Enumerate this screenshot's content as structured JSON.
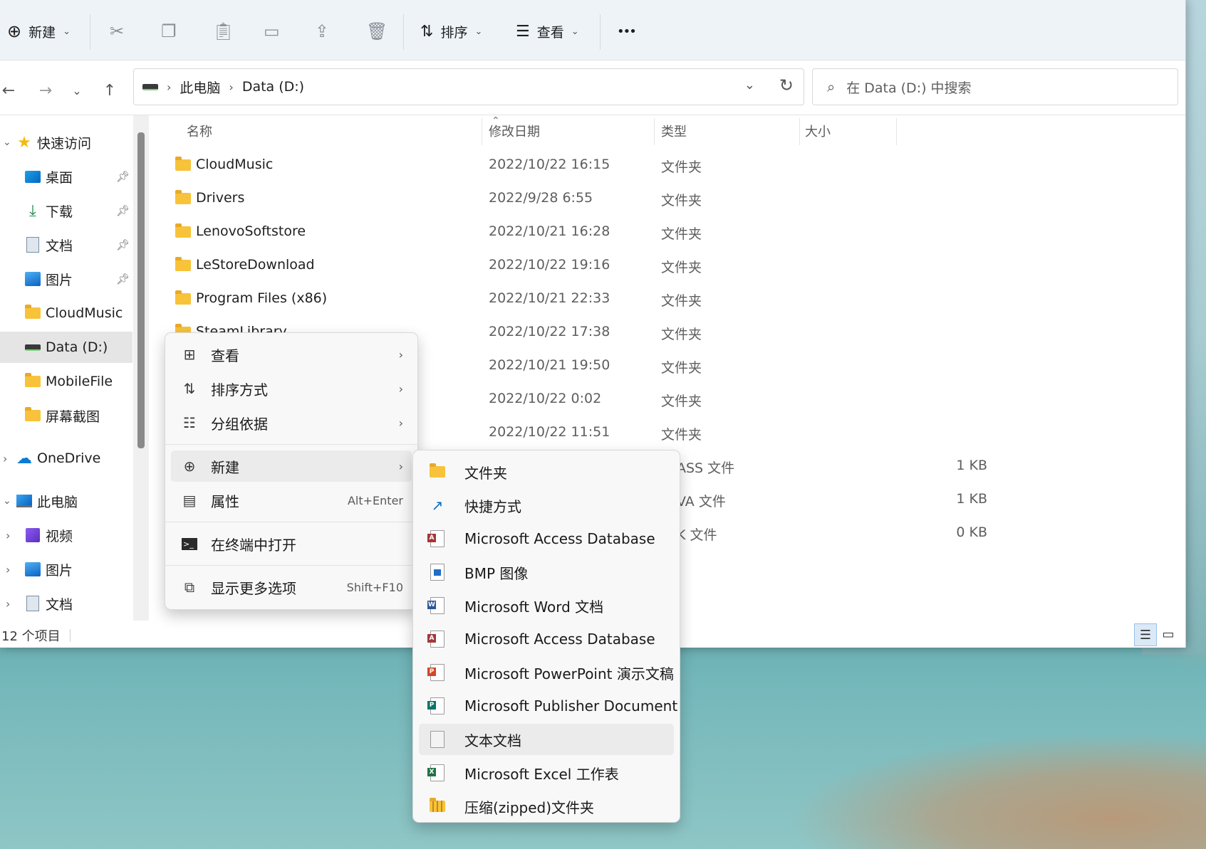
{
  "toolbar": {
    "new_label": "新建",
    "sort_label": "排序",
    "view_label": "查看",
    "more_label": "•••"
  },
  "address": {
    "crumbs": [
      "此电脑",
      "Data (D:)"
    ],
    "search_placeholder": "在 Data (D:) 中搜索"
  },
  "sidebar": {
    "quick_access": "快速访问",
    "items": [
      {
        "label": "桌面",
        "icon": "desktop-icon",
        "pinned": true
      },
      {
        "label": "下载",
        "icon": "download-icon",
        "pinned": true
      },
      {
        "label": "文档",
        "icon": "document-icon",
        "pinned": true
      },
      {
        "label": "图片",
        "icon": "pictures-icon",
        "pinned": true
      },
      {
        "label": "CloudMusic",
        "icon": "folder-icon"
      },
      {
        "label": "Data (D:)",
        "icon": "drive-icon",
        "selected": true
      },
      {
        "label": "MobileFile",
        "icon": "folder-icon"
      },
      {
        "label": "屏幕截图",
        "icon": "folder-icon"
      }
    ],
    "onedrive": "OneDrive",
    "this_pc": "此电脑",
    "pc_items": [
      {
        "label": "视频",
        "icon": "video-icon"
      },
      {
        "label": "图片",
        "icon": "pictures-icon"
      },
      {
        "label": "文档",
        "icon": "document-icon"
      }
    ]
  },
  "columns": {
    "name": "名称",
    "date": "修改日期",
    "type": "类型",
    "size": "大小"
  },
  "files": [
    {
      "name": "CloudMusic",
      "date": "2022/10/22 16:15",
      "type": "文件夹",
      "size": ""
    },
    {
      "name": "Drivers",
      "date": "2022/9/28 6:55",
      "type": "文件夹",
      "size": ""
    },
    {
      "name": "LenovoSoftstore",
      "date": "2022/10/21 16:28",
      "type": "文件夹",
      "size": ""
    },
    {
      "name": "LeStoreDownload",
      "date": "2022/10/22 19:16",
      "type": "文件夹",
      "size": ""
    },
    {
      "name": "Program Files (x86)",
      "date": "2022/10/21 22:33",
      "type": "文件夹",
      "size": ""
    },
    {
      "name": "SteamLibrary",
      "date": "2022/10/22 17:38",
      "type": "文件夹",
      "size": ""
    },
    {
      "name": "",
      "date": "2022/10/21 19:50",
      "type": "文件夹",
      "size": ""
    },
    {
      "name": "",
      "date": "2022/10/22 0:02",
      "type": "文件夹",
      "size": ""
    },
    {
      "name": "",
      "date": "2022/10/22 11:51",
      "type": "文件夹",
      "size": ""
    },
    {
      "name": "",
      "date": "",
      "type": "ASS 文件",
      "size": "1 KB"
    },
    {
      "name": "",
      "date": "",
      "type": "VA 文件",
      "size": "1 KB"
    },
    {
      "name": "",
      "date": "",
      "type": "K 文件",
      "size": "0 KB"
    }
  ],
  "status": {
    "count": "12 个项目"
  },
  "context_menu": {
    "items": [
      {
        "label": "查看",
        "icon": "grid-icon",
        "has_submenu": true
      },
      {
        "label": "排序方式",
        "icon": "sort-icon",
        "has_submenu": true
      },
      {
        "label": "分组依据",
        "icon": "group-icon",
        "has_submenu": true
      },
      {
        "label": "新建",
        "icon": "plus-circle-icon",
        "has_submenu": true,
        "highlighted": true
      },
      {
        "label": "属性",
        "icon": "properties-icon",
        "shortcut": "Alt+Enter"
      },
      {
        "label": "在终端中打开",
        "icon": "terminal-icon"
      },
      {
        "label": "显示更多选项",
        "icon": "expand-icon",
        "shortcut": "Shift+F10"
      }
    ]
  },
  "new_submenu": {
    "items": [
      {
        "label": "文件夹",
        "icon": "folder-icon"
      },
      {
        "label": "快捷方式",
        "icon": "shortcut-icon"
      },
      {
        "label": "Microsoft Access Database",
        "icon": "access-icon"
      },
      {
        "label": "BMP 图像",
        "icon": "bmp-icon"
      },
      {
        "label": "Microsoft Word 文档",
        "icon": "word-icon"
      },
      {
        "label": "Microsoft Access Database",
        "icon": "access-icon"
      },
      {
        "label": "Microsoft PowerPoint 演示文稿",
        "icon": "powerpoint-icon"
      },
      {
        "label": "Microsoft Publisher Document",
        "icon": "publisher-icon"
      },
      {
        "label": "文本文档",
        "icon": "text-file-icon",
        "highlighted": true
      },
      {
        "label": "Microsoft Excel 工作表",
        "icon": "excel-icon"
      },
      {
        "label": "压缩(zipped)文件夹",
        "icon": "zip-folder-icon"
      }
    ]
  },
  "colors": {
    "folder": "#f8c33a",
    "access": "#a4373a",
    "word": "#2b579a",
    "powerpoint": "#d24726",
    "publisher": "#077568",
    "excel": "#217346",
    "accent": "#0067c0"
  }
}
